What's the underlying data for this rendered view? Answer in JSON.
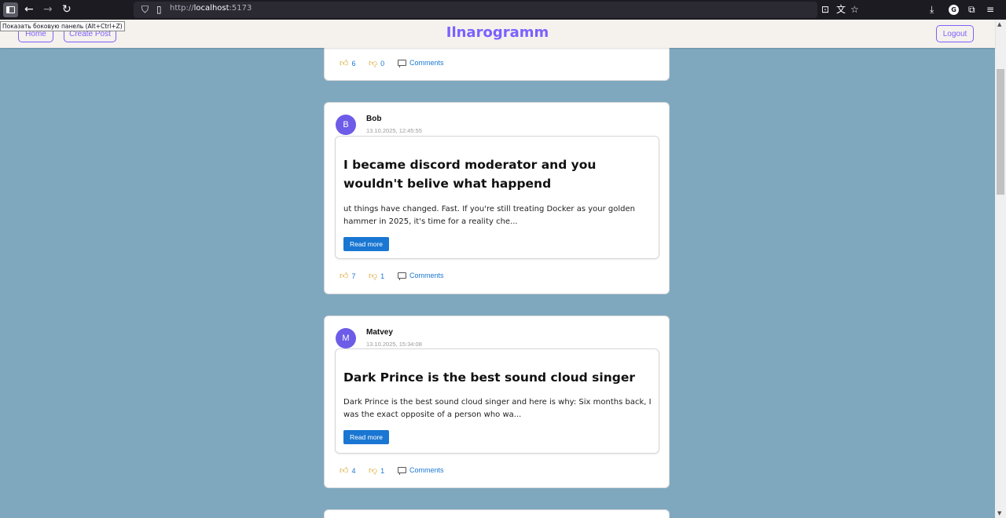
{
  "browser": {
    "url_prefix": "http://",
    "url_host": "localhost",
    "url_port": ":5173",
    "tooltip": "Показать боковую панель (Alt+Ctrl+Z)",
    "profile_initial": "G"
  },
  "header": {
    "brand": "Ilnarogramm",
    "home_label": "Home",
    "create_label": "Create Post",
    "logout_label": "Logout"
  },
  "posts": [
    {
      "likes": "6",
      "dislikes": "0",
      "comments_label": "Comments"
    },
    {
      "initial": "B",
      "author": "Bob",
      "date": "13.10.2025, 12:45:55",
      "title": "I became discord moderator and you wouldn't belive what happend",
      "excerpt": "ut things have changed. Fast. If you're still treating Docker as your golden hammer in 2025, it's time for a reality che...",
      "read_more": "Read more",
      "likes": "7",
      "dislikes": "1",
      "comments_label": "Comments"
    },
    {
      "initial": "M",
      "author": "Matvey",
      "date": "13.10.2025, 15:34:08",
      "title": "Dark Prince is the best sound cloud singer",
      "excerpt": "Dark Prince is the best sound cloud singer and here is why: Six months back, I was the exact opposite of a person who wa...",
      "read_more": "Read more",
      "likes": "4",
      "dislikes": "1",
      "comments_label": "Comments"
    }
  ]
}
